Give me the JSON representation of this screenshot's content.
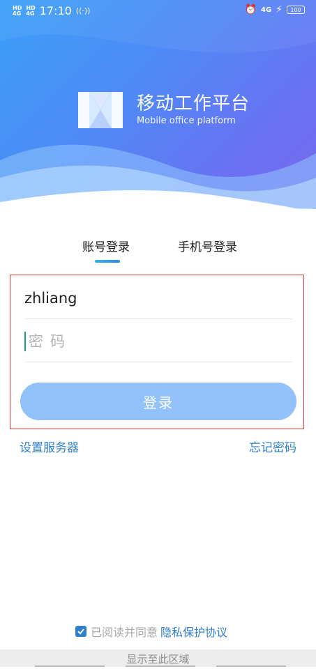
{
  "status": {
    "signal1": "4G",
    "signal1_sup": "HD",
    "signal2": "4G",
    "signal2_sup": "HD",
    "time": "17:10",
    "net": "4G",
    "battery": "100"
  },
  "brand": {
    "title": "移动工作平台",
    "subtitle": "Mobile office platform"
  },
  "tabs": [
    {
      "label": "账号登录",
      "active": true
    },
    {
      "label": "手机号登录",
      "active": false
    }
  ],
  "form": {
    "username_value": "zhliang",
    "password_placeholder": "密码",
    "login_label": "登录"
  },
  "links": {
    "server": "设置服务器",
    "forgot": "忘记密码"
  },
  "agreement": {
    "text": "已阅读并同意",
    "link": "隐私保护协议",
    "checked": true
  },
  "bottom": {
    "text": "显示至此区域"
  },
  "colors": {
    "accent": "#2f7fcb",
    "button": "#92c2f9",
    "highlight_border": "#e53935"
  }
}
